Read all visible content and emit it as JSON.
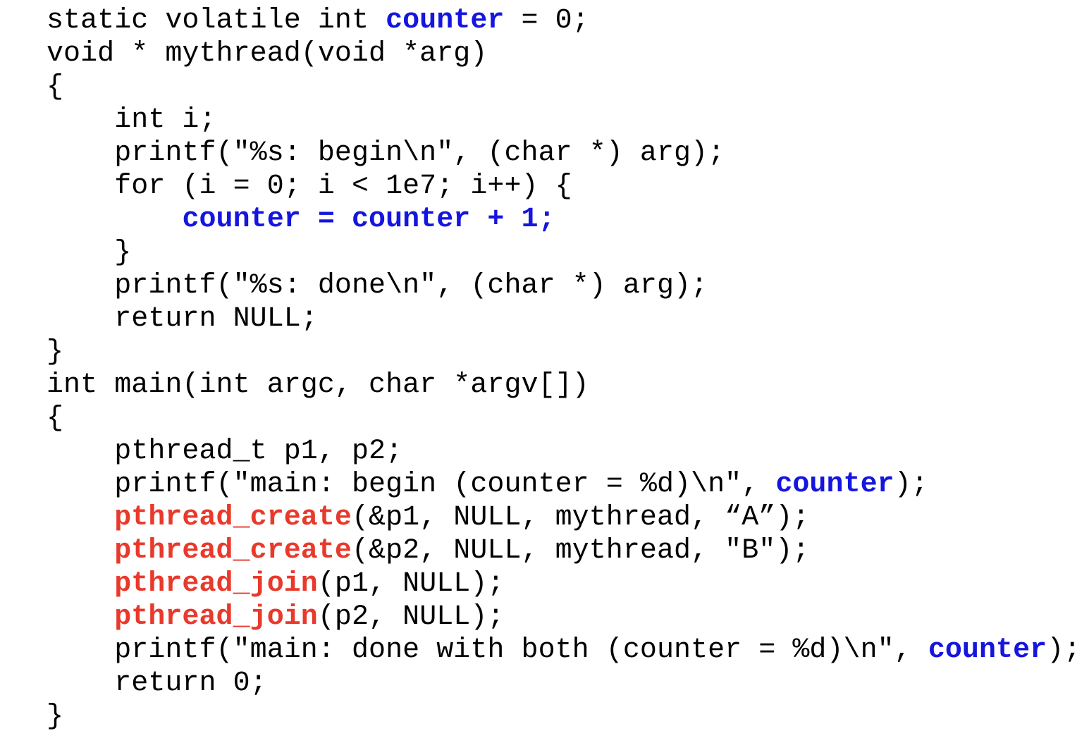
{
  "document": {
    "kind": "source-code-listing",
    "language": "C",
    "background_color": "#ffffff",
    "colors": {
      "plain": "#000000",
      "variable_highlight": "#1515E0",
      "function_highlight": "#E8392B"
    },
    "lines": [
      {
        "index": 0,
        "text": "static volatile int counter = 0;",
        "tokens": [
          {
            "t": "static volatile int ",
            "c": "plain"
          },
          {
            "t": "counter",
            "c": "var"
          },
          {
            "t": " = 0;",
            "c": "plain"
          }
        ]
      },
      {
        "index": 1,
        "text": "void * mythread(void *arg)",
        "tokens": [
          {
            "t": "void * mythread(void *arg)",
            "c": "plain"
          }
        ]
      },
      {
        "index": 2,
        "text": "{",
        "tokens": [
          {
            "t": "{",
            "c": "plain"
          }
        ]
      },
      {
        "index": 3,
        "text": "    int i;",
        "tokens": [
          {
            "t": "    int i;",
            "c": "plain"
          }
        ]
      },
      {
        "index": 4,
        "text": "    printf(\"%s: begin\\n\", (char *) arg);",
        "tokens": [
          {
            "t": "    printf(\"%s: begin\\n\", (char *) arg);",
            "c": "plain"
          }
        ]
      },
      {
        "index": 5,
        "text": "    for (i = 0; i < 1e7; i++) {",
        "tokens": [
          {
            "t": "    for (i = 0; i < 1e7; i++) {",
            "c": "plain"
          }
        ]
      },
      {
        "index": 6,
        "text": "        counter = counter + 1;",
        "tokens": [
          {
            "t": "        ",
            "c": "plain"
          },
          {
            "t": "counter = counter + 1;",
            "c": "var"
          }
        ]
      },
      {
        "index": 7,
        "text": "    }",
        "tokens": [
          {
            "t": "    }",
            "c": "plain"
          }
        ]
      },
      {
        "index": 8,
        "text": "    printf(\"%s: done\\n\", (char *) arg);",
        "tokens": [
          {
            "t": "    printf(\"%s: done\\n\", (char *) arg);",
            "c": "plain"
          }
        ]
      },
      {
        "index": 9,
        "text": "    return NULL;",
        "tokens": [
          {
            "t": "    return NULL;",
            "c": "plain"
          }
        ]
      },
      {
        "index": 10,
        "text": "}",
        "tokens": [
          {
            "t": "}",
            "c": "plain"
          }
        ]
      },
      {
        "index": 11,
        "text": "int main(int argc, char *argv[])",
        "tokens": [
          {
            "t": "int main(int argc, char *argv[])",
            "c": "plain"
          }
        ]
      },
      {
        "index": 12,
        "text": "{",
        "tokens": [
          {
            "t": "{",
            "c": "plain"
          }
        ]
      },
      {
        "index": 13,
        "text": "    pthread_t p1, p2;",
        "tokens": [
          {
            "t": "    pthread_t p1, p2;",
            "c": "plain"
          }
        ]
      },
      {
        "index": 14,
        "text": "    printf(\"main: begin (counter = %d)\\n\", counter);",
        "tokens": [
          {
            "t": "    printf(\"main: begin (counter = %d)\\n\", ",
            "c": "plain"
          },
          {
            "t": "counter",
            "c": "var"
          },
          {
            "t": ");",
            "c": "plain"
          }
        ]
      },
      {
        "index": 15,
        "text": "    pthread_create(&p1, NULL, mythread, “A”);",
        "tokens": [
          {
            "t": "    ",
            "c": "plain"
          },
          {
            "t": "pthread_create",
            "c": "fn"
          },
          {
            "t": "(&p1, NULL, mythread, “A”);",
            "c": "plain"
          }
        ]
      },
      {
        "index": 16,
        "text": "    pthread_create(&p2, NULL, mythread, \"B\");",
        "tokens": [
          {
            "t": "    ",
            "c": "plain"
          },
          {
            "t": "pthread_create",
            "c": "fn"
          },
          {
            "t": "(&p2, NULL, mythread, \"B\");",
            "c": "plain"
          }
        ]
      },
      {
        "index": 17,
        "text": "    pthread_join(p1, NULL);",
        "tokens": [
          {
            "t": "    ",
            "c": "plain"
          },
          {
            "t": "pthread_join",
            "c": "fn"
          },
          {
            "t": "(p1, NULL);",
            "c": "plain"
          }
        ]
      },
      {
        "index": 18,
        "text": "    pthread_join(p2, NULL);",
        "tokens": [
          {
            "t": "    ",
            "c": "plain"
          },
          {
            "t": "pthread_join",
            "c": "fn"
          },
          {
            "t": "(p2, NULL);",
            "c": "plain"
          }
        ]
      },
      {
        "index": 19,
        "text": "    printf(\"main: done with both (counter = %d)\\n\", counter);",
        "tokens": [
          {
            "t": "    printf(\"main: done with both (counter = %d)\\n\", ",
            "c": "plain"
          },
          {
            "t": "counter",
            "c": "var"
          },
          {
            "t": ");",
            "c": "plain"
          }
        ]
      },
      {
        "index": 20,
        "text": "    return 0;",
        "tokens": [
          {
            "t": "    return 0;",
            "c": "plain"
          }
        ]
      },
      {
        "index": 21,
        "text": "}",
        "tokens": [
          {
            "t": "}",
            "c": "plain"
          }
        ]
      }
    ]
  }
}
